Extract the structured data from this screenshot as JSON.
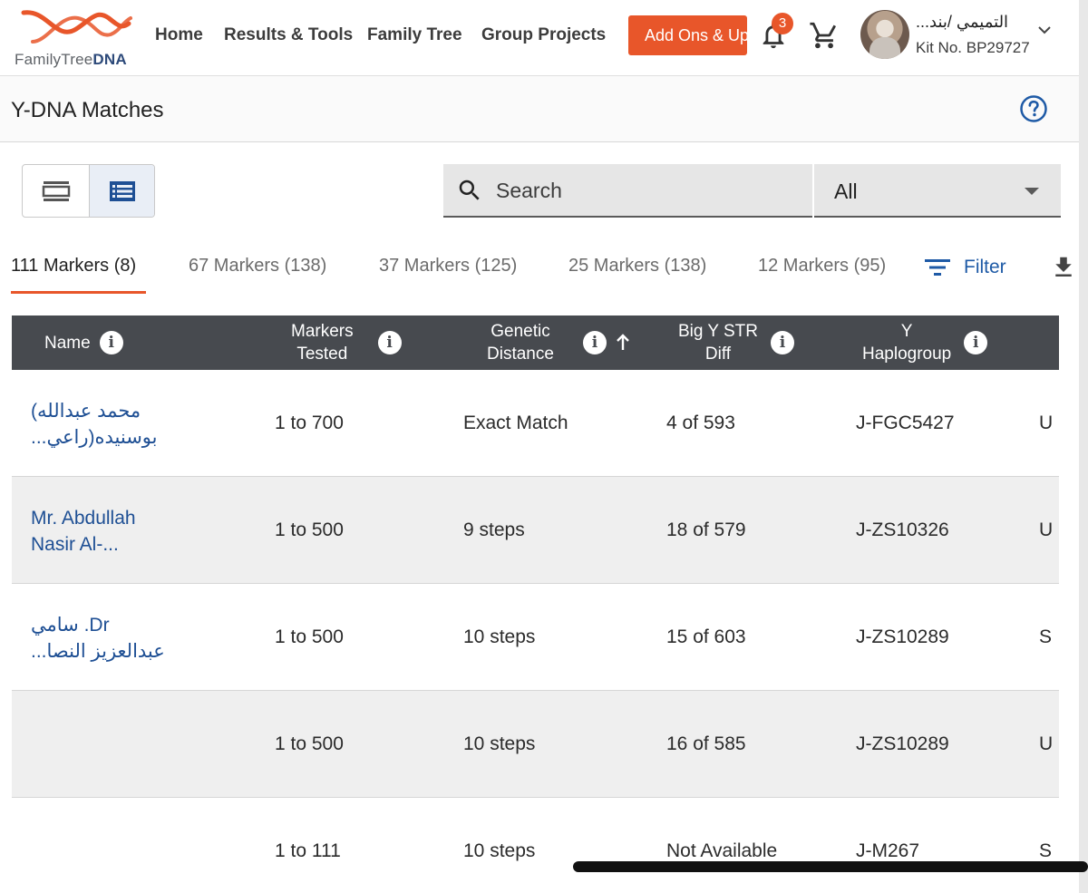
{
  "header": {
    "logo_prefix": "FamilyTree",
    "logo_suffix": "DNA",
    "nav": [
      "Home",
      "Results & Tools",
      "Family Tree",
      "Group Projects"
    ],
    "addons_label": "Add Ons & Upgrades",
    "notification_count": "3",
    "user_name": "التميمي /بند...",
    "kit_no": "Kit No. BP29727",
    "accent_color": "#e8562a"
  },
  "page": {
    "title": "Y-DNA Matches"
  },
  "search": {
    "placeholder": "Search",
    "select_value": "All"
  },
  "tabs": [
    {
      "label": "111 Markers (8)",
      "active": true
    },
    {
      "label": "67 Markers (138)",
      "active": false
    },
    {
      "label": "37 Markers (125)",
      "active": false
    },
    {
      "label": "25 Markers (138)",
      "active": false
    },
    {
      "label": "12 Markers (95)",
      "active": false
    }
  ],
  "filter_label": "Filter",
  "table": {
    "columns": {
      "name": "Name",
      "markers_line1": "Markers",
      "markers_line2": "Tested",
      "gd_line1": "Genetic",
      "gd_line2": "Distance",
      "bigy_line1": "Big Y STR",
      "bigy_line2": "Diff",
      "hap_line1": "Y",
      "hap_line2": "Haplogroup"
    },
    "rows": [
      {
        "name_line1": "محمد عبدالله)",
        "name_line2": "بوسنيده(راعي...",
        "markers": "1 to 700",
        "distance": "Exact Match",
        "bigy": "4 of 593",
        "haplogroup": "J-FGC5427",
        "extra": "U"
      },
      {
        "name_line1": "Mr. Abdullah",
        "name_line2": "Nasir Al-...",
        "markers": "1 to 500",
        "distance": "9 steps",
        "bigy": "18 of 579",
        "haplogroup": "J-ZS10326",
        "extra": "U"
      },
      {
        "name_line1": "Dr. سامي",
        "name_line2": "عبدالعزيز النصا...",
        "markers": "1 to 500",
        "distance": "10 steps",
        "bigy": "15 of 603",
        "haplogroup": "J-ZS10289",
        "extra": "S"
      },
      {
        "name_line1": "",
        "name_line2": "",
        "markers": "1 to 500",
        "distance": "10 steps",
        "bigy": "16 of 585",
        "haplogroup": "J-ZS10289",
        "extra": "U"
      },
      {
        "name_line1": "",
        "name_line2": "",
        "markers": "1 to 111",
        "distance": "10 steps",
        "bigy": "Not Available",
        "haplogroup": "J-M267",
        "extra": "S"
      }
    ]
  }
}
